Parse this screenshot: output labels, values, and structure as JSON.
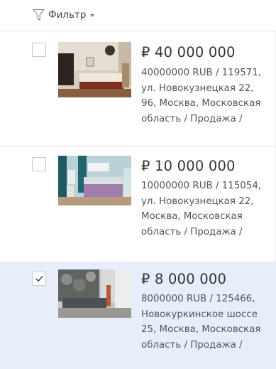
{
  "toolbar": {
    "filter_label": "Фильтр",
    "filter_icon": "funnel-icon",
    "caret_icon": "chevron-down-icon"
  },
  "colors": {
    "selected_row_bg": "#e6eefb",
    "text": "#444444"
  },
  "listings": [
    {
      "price": "₽ 40 000 000",
      "description_lines": [
        "40000000 RUB / 119571,",
        "ул. Новокузнецкая 22,",
        "96, Москва, Московская",
        "область / Продажа /"
      ],
      "checked": false,
      "thumbnail": "bedroom-photo"
    },
    {
      "price": "₽ 10 000 000",
      "description_lines": [
        "10000000 RUB / 115054,",
        "ул. Новокузнецкая 22,",
        "Москва, Московская",
        "область / Продажа /"
      ],
      "checked": false,
      "thumbnail": "bedroom-photo"
    },
    {
      "price": "₽ 8 000 000",
      "description_lines": [
        "8000000 RUB / 125466,",
        "Новокуркинское шоссе",
        "25, Москва, Московская",
        "область / Продажа /"
      ],
      "checked": true,
      "thumbnail": "living-room-photo"
    }
  ]
}
